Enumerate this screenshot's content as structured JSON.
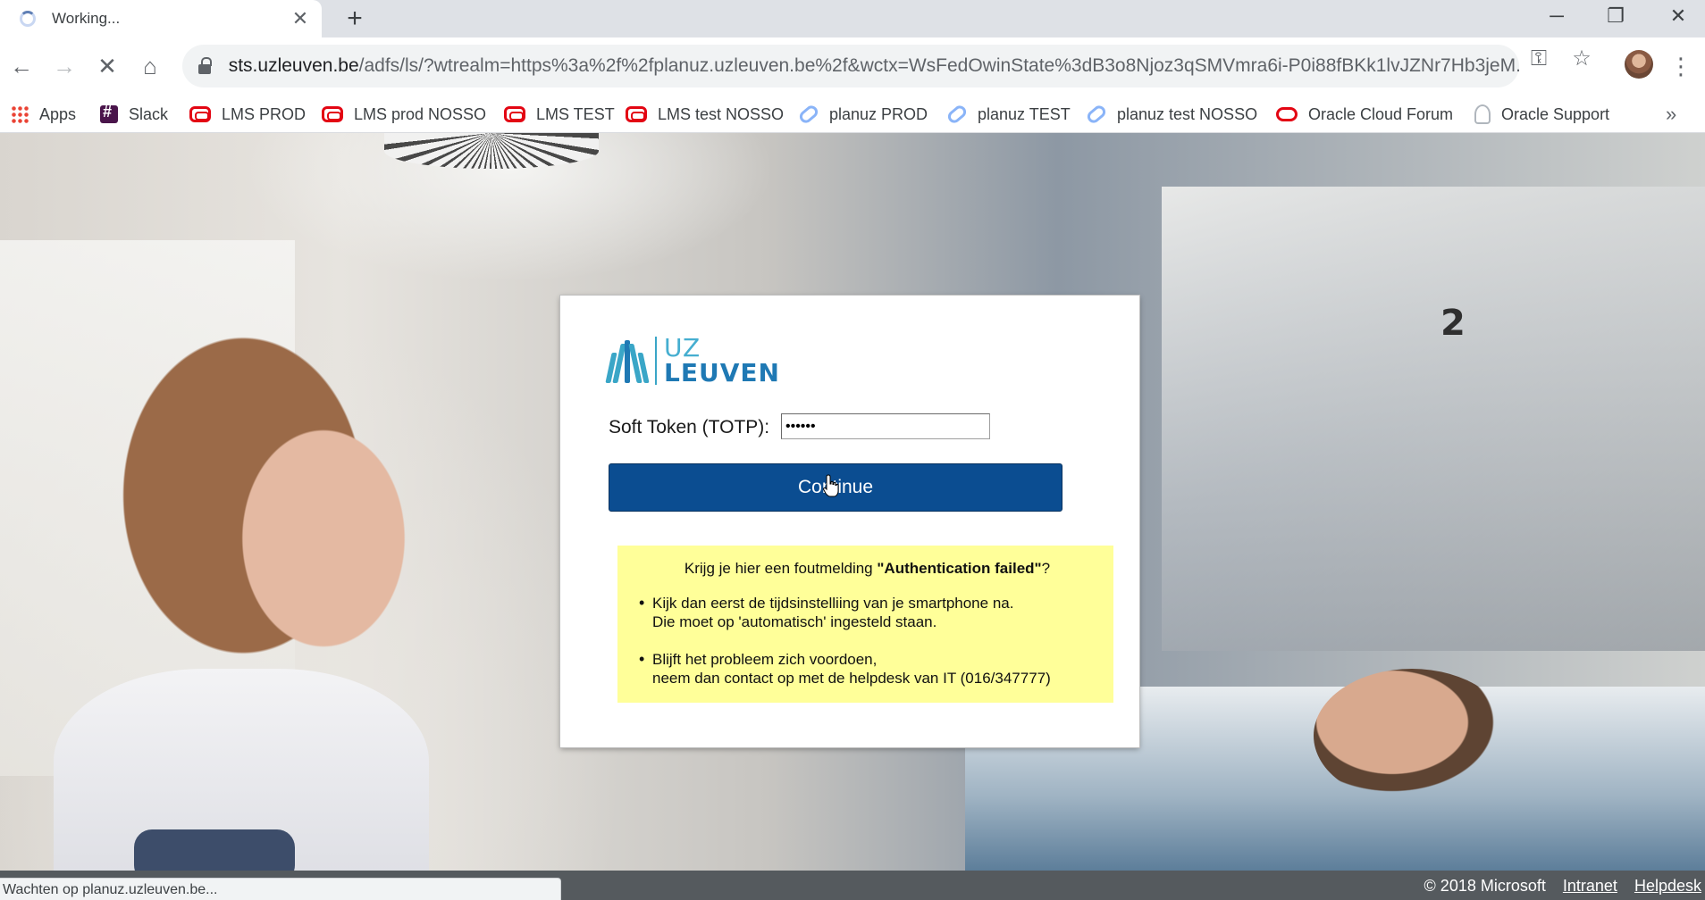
{
  "tab": {
    "title": "Working...",
    "close_glyph": "✕"
  },
  "newtab_glyph": "+",
  "window_controls": {
    "minimize": "─",
    "restore": "❐",
    "close": "✕"
  },
  "toolbar": {
    "back_glyph": "←",
    "forward_glyph": "→",
    "stop_glyph": "✕",
    "home_glyph": "⌂",
    "url_host": "sts.uzleuven.be",
    "url_rest": "/adfs/ls/?wtrealm=https%3a%2f%2fplanuz.uzleuven.be%2f&wctx=WsFedOwinState%3dB3o8Njoz3qSMVmra6i-P0i88fBKk1lvJZNr7Hb3jeM...",
    "key_glyph": "⚿",
    "star_glyph": "☆",
    "menu_glyph": "⋮"
  },
  "bookmarks": [
    {
      "label": "Apps",
      "icon": "apps-grid-icon"
    },
    {
      "label": "Slack",
      "icon": "slack-icon"
    },
    {
      "label": "LMS PROD",
      "icon": "oracle-icon"
    },
    {
      "label": "LMS prod NOSSO",
      "icon": "oracle-icon"
    },
    {
      "label": "LMS TEST",
      "icon": "oracle-icon"
    },
    {
      "label": "LMS test NOSSO",
      "icon": "oracle-icon"
    },
    {
      "label": "planuz PROD",
      "icon": "link-icon"
    },
    {
      "label": "planuz TEST",
      "icon": "link-icon"
    },
    {
      "label": "planuz test NOSSO",
      "icon": "link-icon"
    },
    {
      "label": "Oracle Cloud Forum",
      "icon": "oracle-ring-icon"
    },
    {
      "label": "Oracle Support",
      "icon": "oracle-support-icon"
    }
  ],
  "bookmarks_more": "»",
  "login": {
    "logo_uz": "UZ",
    "logo_leuven": "LEUVEN",
    "token_label": "Soft Token (TOTP):",
    "token_value": "••••••",
    "continue_label": "Continue",
    "notice": {
      "title_prefix": "Krijg je hier een foutmelding ",
      "title_bold": "\"Authentication failed\"",
      "title_suffix": "?",
      "item1_line1": "Kijk dan eerst de tijdsinstelliing van je smartphone na.",
      "item1_line2": "Die moet op 'automatisch' ingesteld staan.",
      "item2_line1": "Blijft het probleem zich voordoen,",
      "item2_line2": "neem dan contact op met de helpdesk van IT (016/347777)"
    }
  },
  "footer": {
    "copyright": "© 2018 Microsoft",
    "intranet": "Intranet",
    "helpdesk": "Helpdesk"
  },
  "status_text": "Wachten op planuz.uzleuven.be...",
  "colors": {
    "button": "#0b4d91",
    "notice_bg": "#ffff99",
    "footer_bg": "#555a5e",
    "logo_light": "#45aed0",
    "logo_dark": "#1f79b4"
  }
}
